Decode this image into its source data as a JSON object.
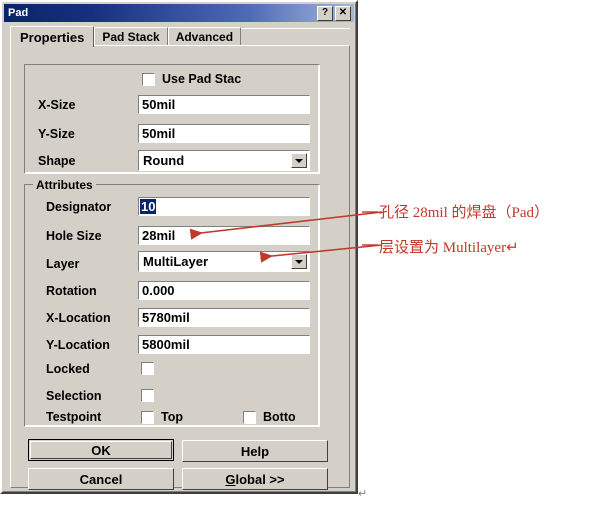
{
  "window": {
    "title": "Pad",
    "help_button": "?",
    "close_button": "✕",
    "resize_mark": "↵"
  },
  "tabs": [
    {
      "label": "Properties",
      "active": true
    },
    {
      "label": "Pad Stack",
      "active": false
    },
    {
      "label": "Advanced",
      "active": false
    }
  ],
  "size_group": {
    "use_pad_stack_label": "Use Pad Stac",
    "use_pad_stack_checked": false,
    "fields": [
      {
        "label": "X-Size",
        "value": "50mil"
      },
      {
        "label": "Y-Size",
        "value": "50mil"
      }
    ],
    "shape": {
      "label": "Shape",
      "value": "Round"
    }
  },
  "attributes_group": {
    "title": "Attributes",
    "designator": {
      "label": "Designator",
      "value": "10"
    },
    "hole_size": {
      "label": "Hole Size",
      "value": "28mil"
    },
    "layer": {
      "label": "Layer",
      "value": "MultiLayer"
    },
    "rotation": {
      "label": "Rotation",
      "value": "0.000"
    },
    "x_location": {
      "label": "X-Location",
      "value": "5780mil"
    },
    "y_location": {
      "label": "Y-Location",
      "value": "5800mil"
    },
    "locked": {
      "label": "Locked",
      "checked": false
    },
    "selection": {
      "label": "Selection",
      "checked": false
    },
    "testpoint": {
      "label": "Testpoint",
      "top": {
        "label": "Top",
        "checked": false
      },
      "bottom": {
        "label": "Botto",
        "checked": false
      }
    }
  },
  "buttons": {
    "ok": "OK",
    "help": "Help",
    "cancel": "Cancel",
    "global_prefix": "G",
    "global_rest": "lobal >>"
  },
  "annotations": {
    "colors": {
      "red": "#c0392b"
    },
    "line1": "孔径 28mil 的焊盘（Pad）",
    "line2": "层设置为 Multilayer↵"
  }
}
